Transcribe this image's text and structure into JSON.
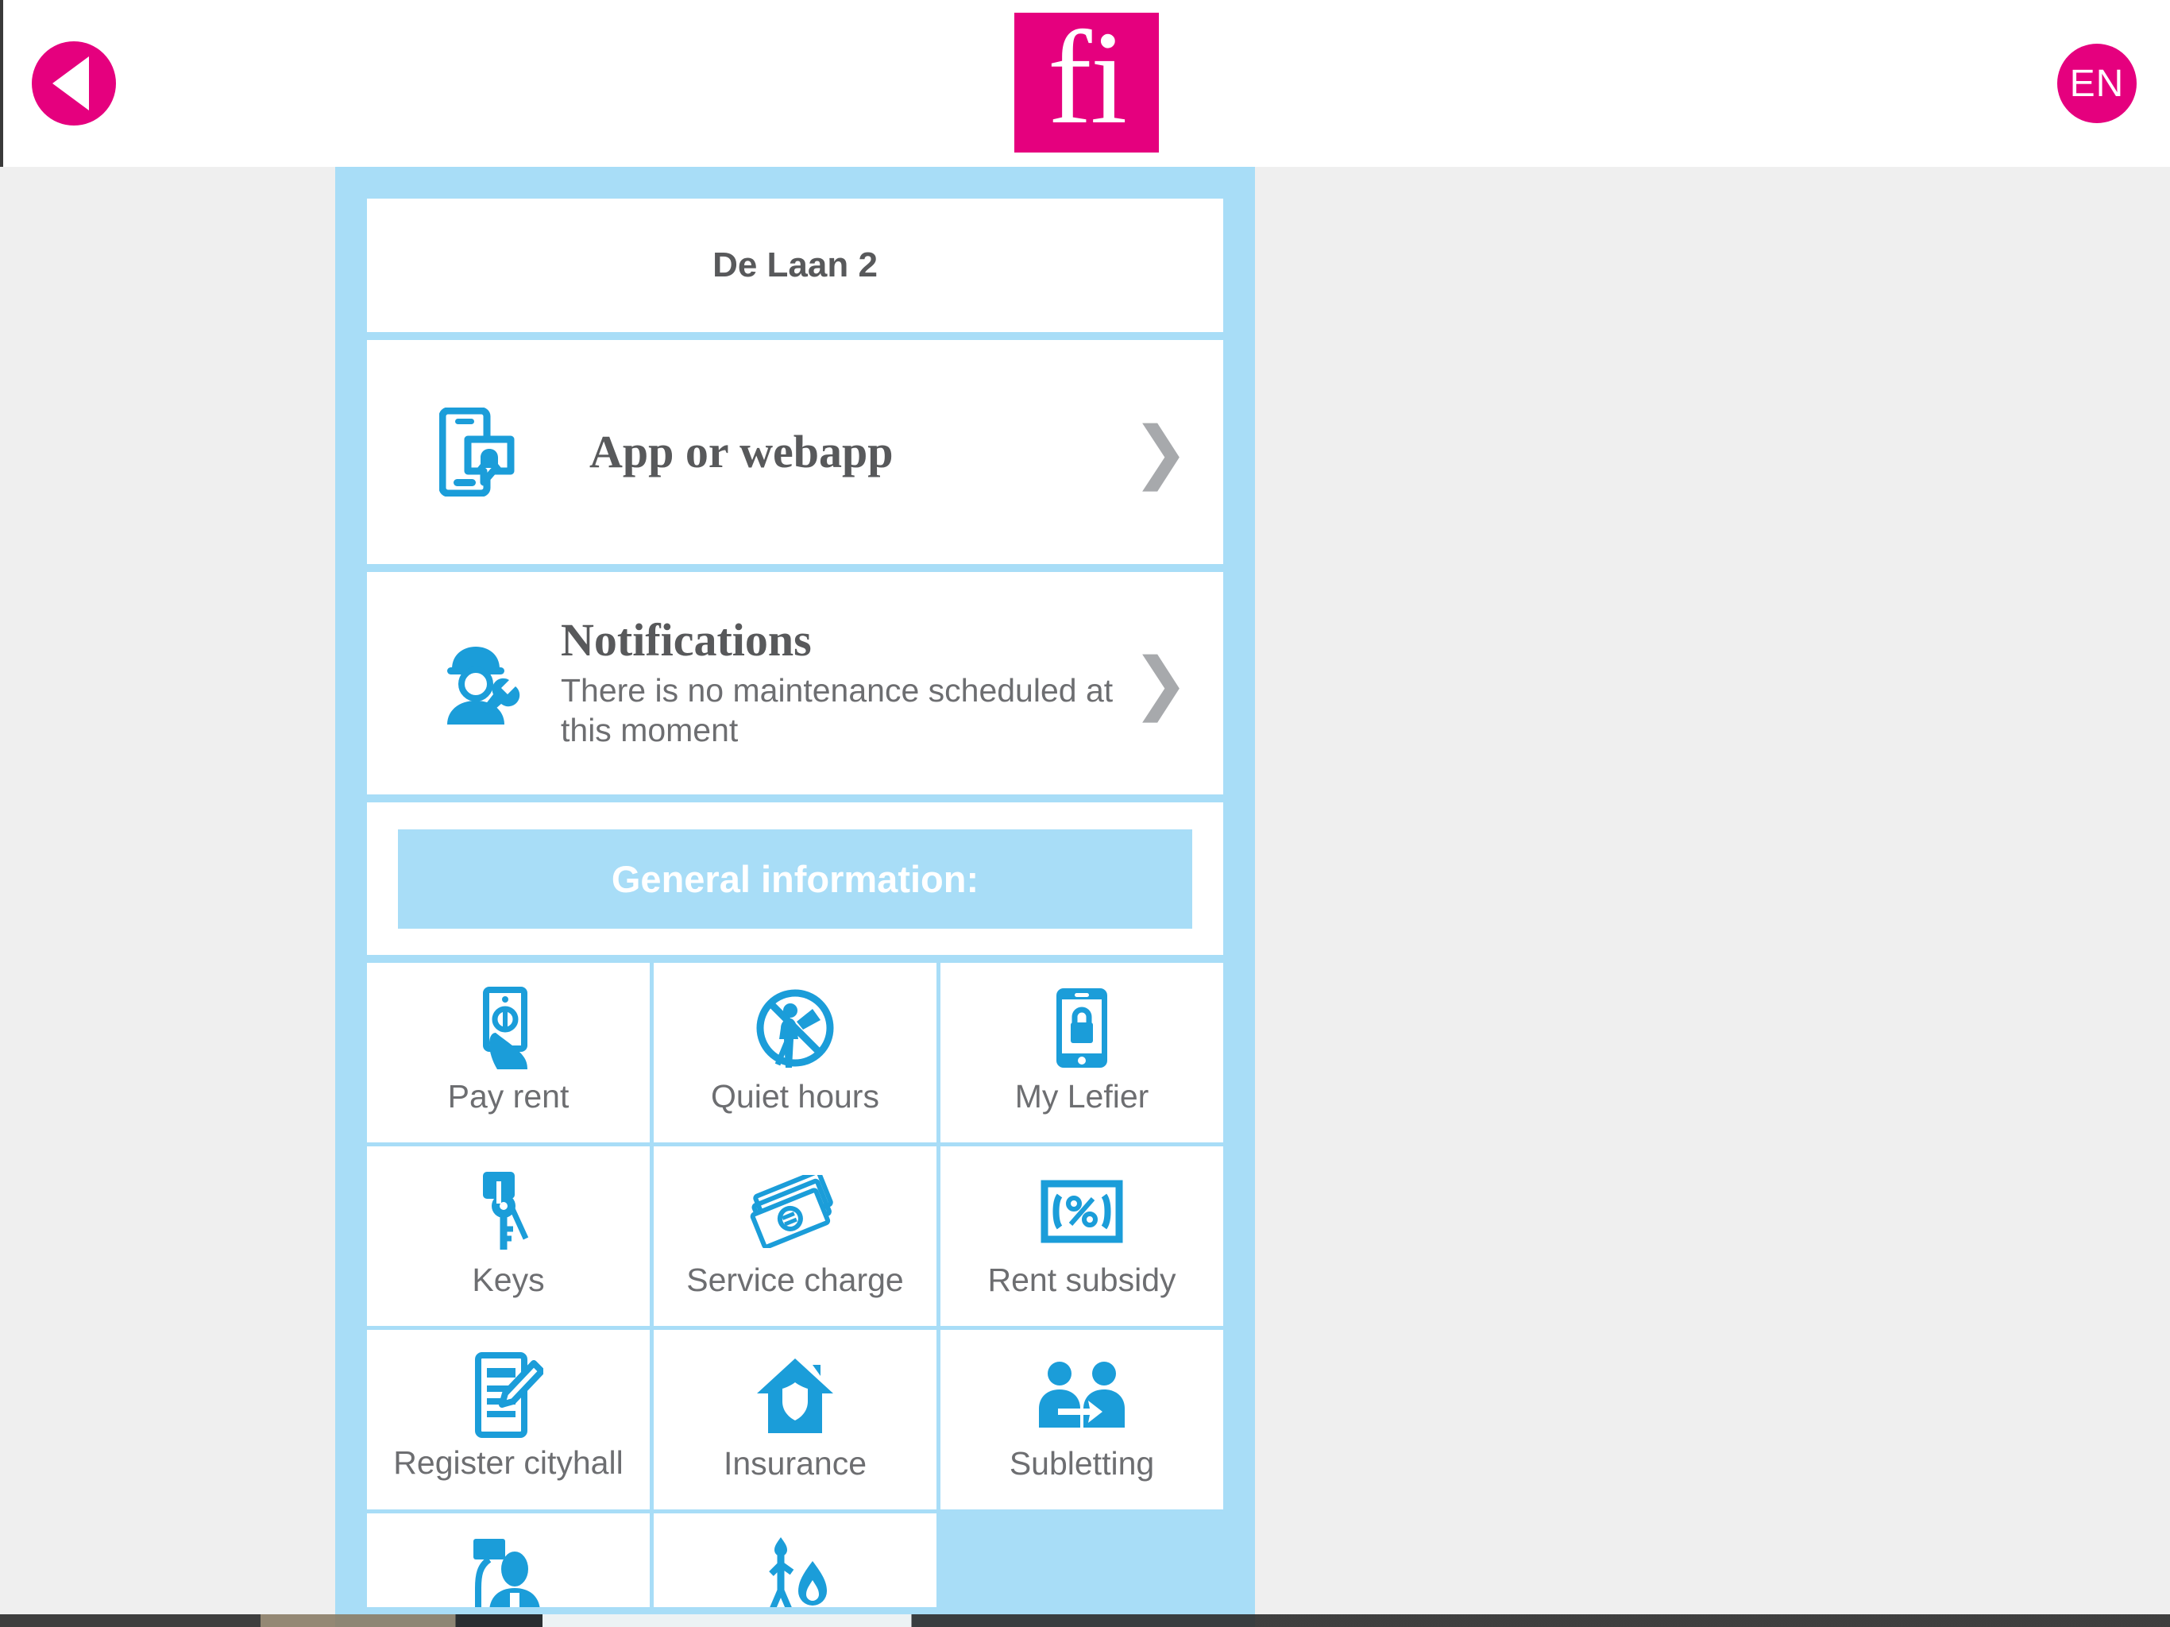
{
  "header": {
    "back_label": "back",
    "back_icon": "triangle-left-icon",
    "logo_text": "fi",
    "language_label": "EN",
    "brand_color": "#e5007e"
  },
  "colors": {
    "accent_blue": "#a8ddf7",
    "icon_blue": "#1b9dd9",
    "page_background": "#efefef",
    "text_gray": "#6d6e71"
  },
  "address": {
    "title": "De Laan 2"
  },
  "rows": [
    {
      "icon": "phone-notification-icon",
      "title": "App or webapp",
      "subtitle": "",
      "chevron": "❯"
    },
    {
      "icon": "maintenance-worker-icon",
      "title": "Notifications",
      "subtitle": "There is no maintenance scheduled at this moment",
      "chevron": "❯"
    }
  ],
  "general_information": {
    "banner_label": "General information:"
  },
  "tiles": [
    {
      "label": "Pay rent",
      "icon": "hand-banknote-icon"
    },
    {
      "label": "Quiet hours",
      "icon": "no-vacuuming-icon"
    },
    {
      "label": "My Lefier",
      "icon": "phone-lock-icon"
    },
    {
      "label": "Keys",
      "icon": "keys-icon"
    },
    {
      "label": "Service charge",
      "icon": "banknotes-euro-icon"
    },
    {
      "label": "Rent subsidy",
      "icon": "percent-box-icon"
    },
    {
      "label": "Register cityhall",
      "icon": "document-pencil-icon"
    },
    {
      "label": "Insurance",
      "icon": "house-shield-icon"
    },
    {
      "label": "Subletting",
      "icon": "two-people-arrow-icon"
    },
    {
      "label": "",
      "icon": "painter-sign-icon"
    },
    {
      "label": "",
      "icon": "person-fire-icon"
    },
    {
      "label": "",
      "icon": ""
    }
  ]
}
